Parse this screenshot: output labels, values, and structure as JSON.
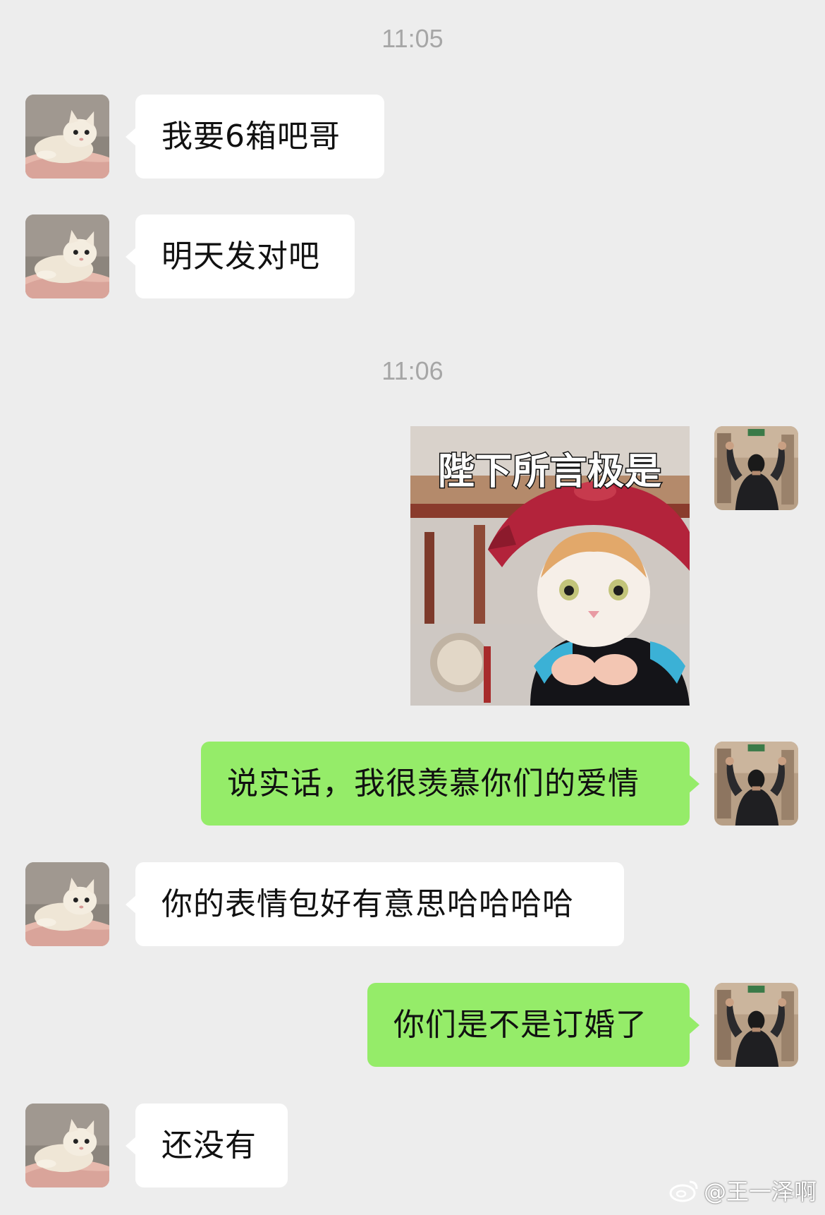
{
  "timestamps": [
    "11:05",
    "11:06"
  ],
  "messages": [
    {
      "side": "in",
      "text": "我要6箱吧哥"
    },
    {
      "side": "in",
      "text": "明天发对吧"
    },
    {
      "side": "out",
      "type": "sticker",
      "caption": "陛下所言极是"
    },
    {
      "side": "out",
      "text": "说实话，我很羡慕你们的爱情"
    },
    {
      "side": "in",
      "text": "你的表情包好有意思哈哈哈哈"
    },
    {
      "side": "out",
      "text": "你们是不是订婚了"
    },
    {
      "side": "in",
      "text": "还没有"
    }
  ],
  "avatars": {
    "contact": "cat-avatar",
    "self": "person-back-avatar"
  },
  "watermark": {
    "icon": "weibo-icon",
    "text": "@王一泽啊"
  },
  "colors": {
    "background": "#ededed",
    "incoming_bubble": "#ffffff",
    "outgoing_bubble": "#95ec69",
    "timestamp": "#a6a6a6"
  }
}
